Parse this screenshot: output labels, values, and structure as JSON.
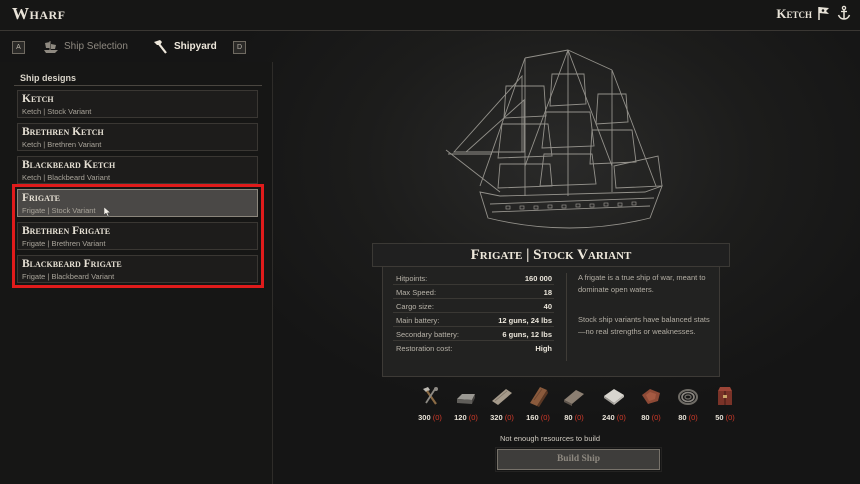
{
  "header": {
    "title": "Wharf",
    "ship_name": "Ketch"
  },
  "tabs": {
    "left_key": "A",
    "right_key": "D",
    "items": [
      {
        "label": "Ship Selection",
        "active": false
      },
      {
        "label": "Shipyard",
        "active": true
      }
    ]
  },
  "sidebar": {
    "section_title": "Ship designs",
    "designs": [
      {
        "name": "Ketch",
        "subtitle": "Ketch | Stock Variant",
        "selected": false
      },
      {
        "name": "Brethren Ketch",
        "subtitle": "Ketch | Brethren Variant",
        "selected": false
      },
      {
        "name": "Blackbeard Ketch",
        "subtitle": "Ketch | Blackbeard Variant",
        "selected": false
      },
      {
        "name": "Frigate",
        "subtitle": "Frigate | Stock Variant",
        "selected": true
      },
      {
        "name": "Brethren Frigate",
        "subtitle": "Frigate | Brethren Variant",
        "selected": false
      },
      {
        "name": "Blackbeard Frigate",
        "subtitle": "Frigate | Blackbeard Variant",
        "selected": false
      }
    ]
  },
  "details": {
    "title": "Frigate | Stock Variant",
    "stats": [
      {
        "label": "Hitpoints:",
        "value": "160 000"
      },
      {
        "label": "Max Speed:",
        "value": "18"
      },
      {
        "label": "Cargo size:",
        "value": "40"
      },
      {
        "label": "Main battery:",
        "value": "12 guns, 24 lbs"
      },
      {
        "label": "Secondary battery:",
        "value": "6 guns, 12 lbs"
      },
      {
        "label": "Restoration cost:",
        "value": "High"
      }
    ],
    "description_1": "A frigate is a true ship of war, meant to dominate open waters.",
    "description_2": "Stock ship variants have balanced stats—no real strengths or weaknesses."
  },
  "resources": [
    {
      "icon": "tools-icon",
      "need": "300",
      "have": "(0)"
    },
    {
      "icon": "iron-ingot-icon",
      "need": "120",
      "have": "(0)"
    },
    {
      "icon": "wood-plank-icon",
      "need": "320",
      "have": "(0)"
    },
    {
      "icon": "timber-icon",
      "need": "160",
      "have": "(0)"
    },
    {
      "icon": "hardwood-plank-icon",
      "need": "80",
      "have": "(0)"
    },
    {
      "icon": "cloth-icon",
      "need": "240",
      "have": "(0)"
    },
    {
      "icon": "leather-icon",
      "need": "80",
      "have": "(0)"
    },
    {
      "icon": "rope-icon",
      "need": "80",
      "have": "(0)"
    },
    {
      "icon": "chest-icon",
      "need": "50",
      "have": "(0)"
    }
  ],
  "footer": {
    "warning": "Not enough resources to build",
    "build_label": "Build Ship"
  },
  "colors": {
    "highlight_border": "#e01b1b",
    "missing_resource": "#d23a2a",
    "panel_bg": "#222221"
  }
}
